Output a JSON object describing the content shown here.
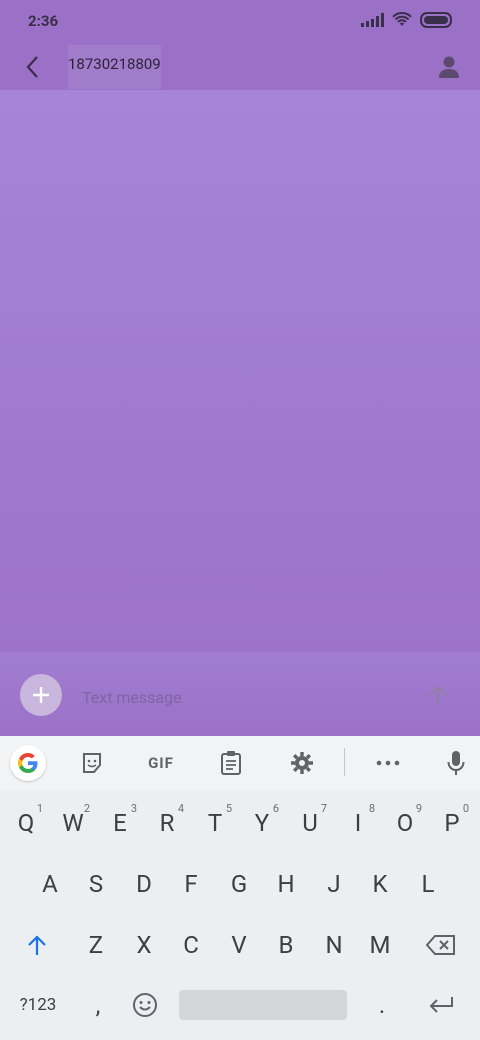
{
  "status": {
    "time": "2:36"
  },
  "header": {
    "contact_number": "18730218809"
  },
  "compose": {
    "placeholder": "Text message"
  },
  "keyboard": {
    "toolbar": {
      "gif_label": "GIF"
    },
    "row1": [
      "Q",
      "W",
      "E",
      "R",
      "T",
      "Y",
      "U",
      "I",
      "O",
      "P"
    ],
    "row1_numbers": [
      "1",
      "2",
      "3",
      "4",
      "5",
      "6",
      "7",
      "8",
      "9",
      "0"
    ],
    "row2": [
      "A",
      "S",
      "D",
      "F",
      "G",
      "H",
      "J",
      "K",
      "L"
    ],
    "row3": [
      "Z",
      "X",
      "C",
      "V",
      "B",
      "N",
      "M"
    ],
    "bottom": {
      "symbols": "?123",
      "comma": ",",
      "period": "."
    }
  }
}
